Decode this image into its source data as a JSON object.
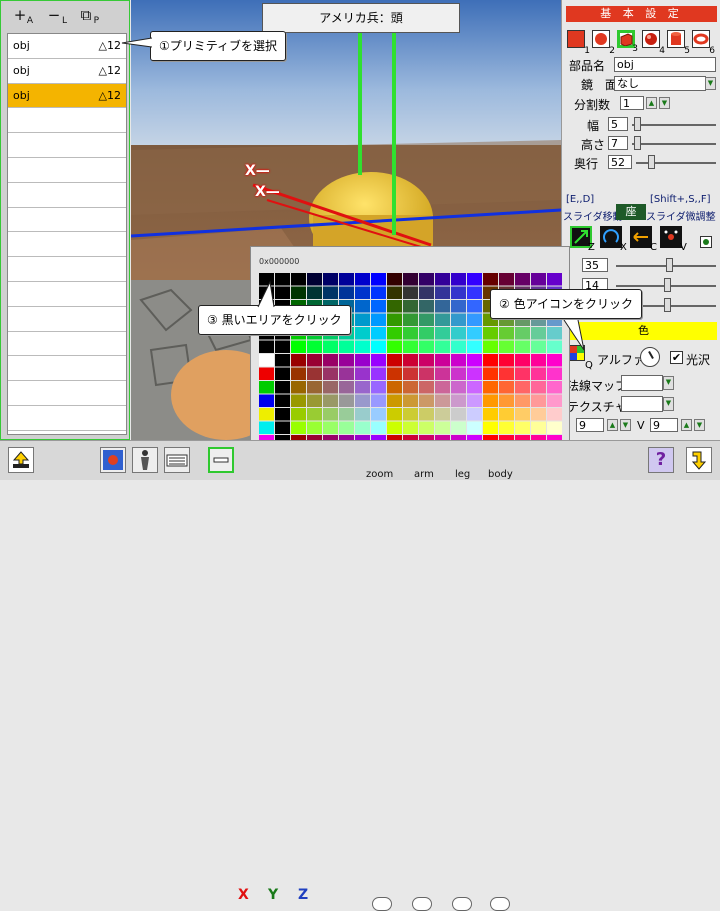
{
  "left_toolbar": {
    "add_label": "+",
    "add_sub": "A",
    "remove_label": "−",
    "remove_sub": "L",
    "copy_label": "⧉",
    "copy_sub": "P"
  },
  "object_list": [
    {
      "name": "obj",
      "count": "△12",
      "selected": false
    },
    {
      "name": "obj",
      "count": "△12",
      "selected": false
    },
    {
      "name": "obj",
      "count": "△12",
      "selected": true
    }
  ],
  "viewport": {
    "title": "アメリカ兵：頭",
    "axis_marker_1": "X",
    "axis_marker_2": "X"
  },
  "callouts": {
    "step1": "①プリミティブを選択",
    "step2": "② 色アイコンをクリック",
    "step3": "③ 黒いエリアをクリック"
  },
  "right_panel": {
    "header": "基 本 設 定",
    "primitives": [
      {
        "num": "1",
        "color": "#e03820",
        "shape": "box"
      },
      {
        "num": "2",
        "color": "#e03820",
        "shape": "sphere"
      },
      {
        "num": "3",
        "color": "#e03820",
        "shape": "cube"
      },
      {
        "num": "4",
        "color": "#e03820",
        "shape": "ball"
      },
      {
        "num": "5",
        "color": "#e03820",
        "shape": "cylinder"
      },
      {
        "num": "6",
        "color": "#e03820",
        "shape": "torus"
      }
    ],
    "part_name_label": "部品名",
    "part_name_value": "obj",
    "mirror_label": "鏡　面",
    "mirror_value": "なし",
    "divisions_label": "分割数",
    "divisions_value": "1",
    "width_label": "幅",
    "width_value": "5",
    "height_label": "高さ",
    "height_value": "7",
    "depth_label": "奥行",
    "depth_value": "52",
    "slider_move_keys": "[E,,D]",
    "slider_move_label": "スライダ移動",
    "slider_fine_keys": "[Shift+,S,,F]",
    "slider_fine_label": "スライダ微調整",
    "coord_label": "座",
    "tool_subs": [
      "Z",
      "X",
      "C",
      "V"
    ],
    "pos_value_1": "35",
    "pos_value_2": "14",
    "pos_value_3": "",
    "color_label": "色",
    "color_sub": "Q",
    "alpha_label": "アルファ",
    "gloss_label": "光沢",
    "gloss_checked": "✔",
    "normal_map_label": "法線マップ",
    "texture_label": "テクスチャ",
    "u_value": "9",
    "v_label": "V",
    "v_value": "9"
  },
  "color_picker": {
    "hex": "0x000000"
  },
  "bottom_bar": {
    "zoom_label": "zoom",
    "arm_label": "arm",
    "leg_label": "leg",
    "body_label": "body",
    "help_label": "?"
  },
  "colors": {
    "accent": "#e03820",
    "selection": "#f4b400",
    "green_outline": "#2fc92f",
    "color_bar": "#ffff00"
  }
}
